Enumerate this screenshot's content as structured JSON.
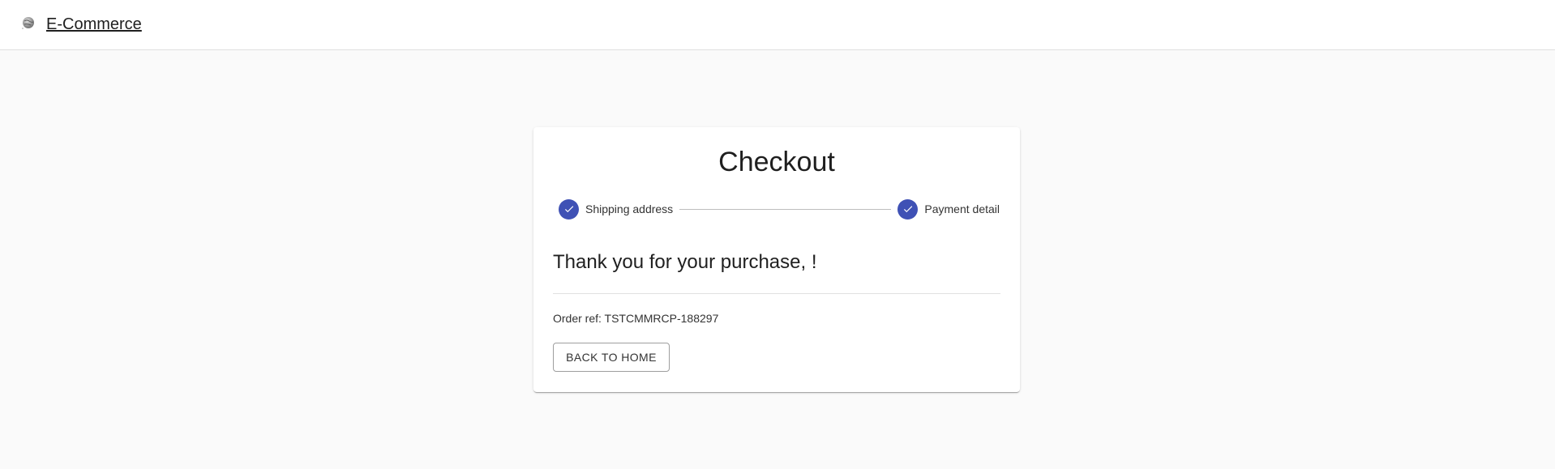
{
  "header": {
    "brand": "E-Commerce",
    "logo_icon": "globe-logo-icon"
  },
  "checkout": {
    "title": "Checkout",
    "steps": [
      {
        "label": "Shipping address",
        "status": "completed",
        "icon": "check-icon"
      },
      {
        "label": "Payment detail",
        "status": "completed",
        "icon": "check-icon"
      }
    ],
    "thank_you": "Thank you for your purchase, !",
    "order_ref": "Order ref: TSTCMMRCP-188297",
    "back_button": "BACK TO HOME"
  },
  "colors": {
    "accent": "#3f51b5",
    "background": "#fafafa",
    "card": "#ffffff"
  }
}
